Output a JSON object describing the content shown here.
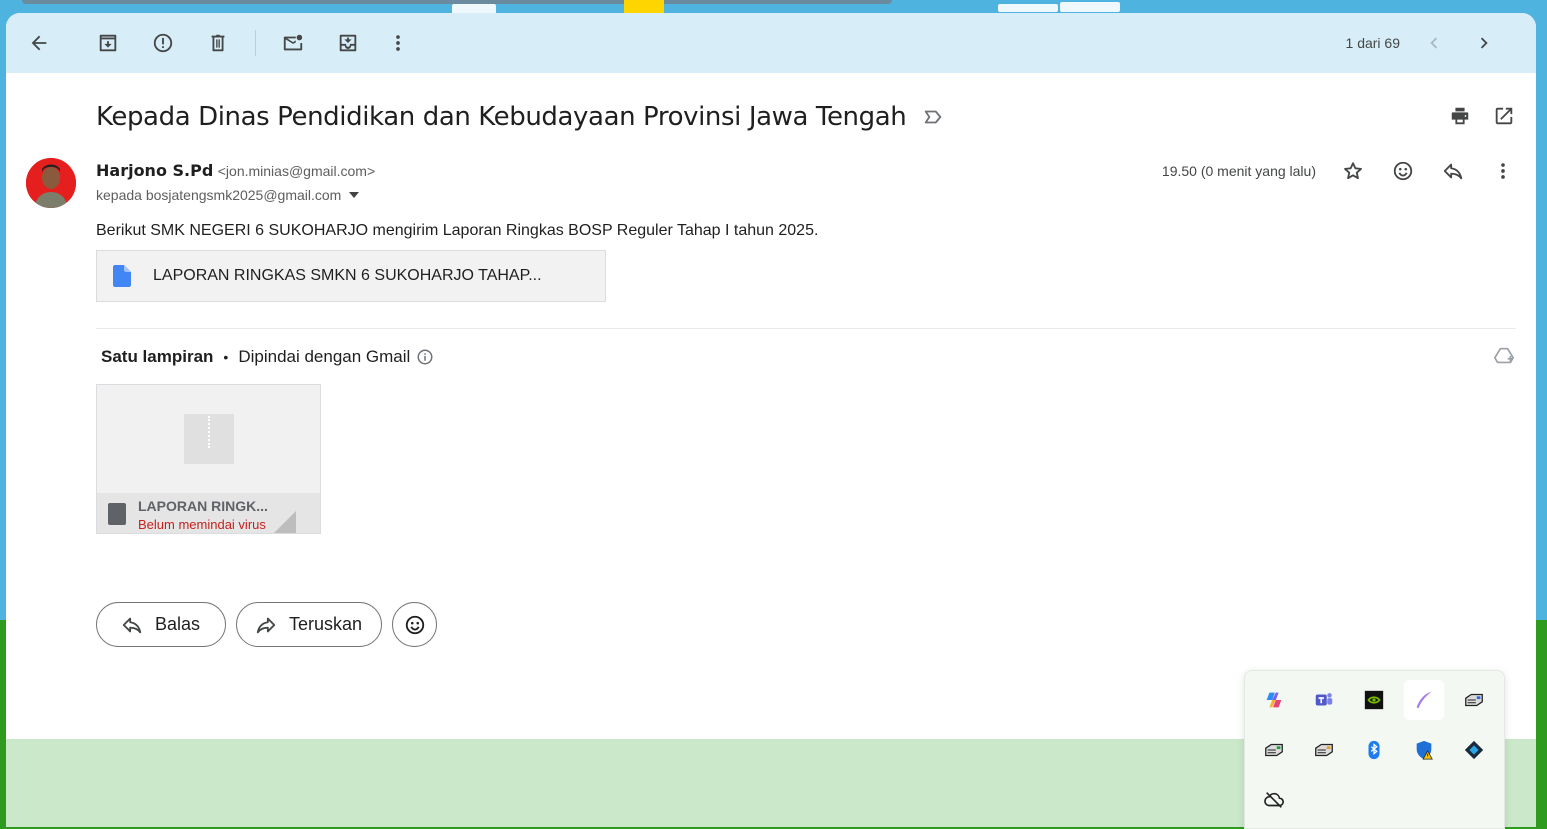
{
  "toolbar": {
    "buttons": [
      "back-icon",
      "archive-icon",
      "report-spam-icon",
      "delete-icon",
      "mark-unread-icon",
      "move-to-icon",
      "more-vert-icon"
    ],
    "pager_text": "1 dari 69"
  },
  "email": {
    "subject": "Kepada Dinas Pendidikan dan Kebudayaan Provinsi Jawa Tengah",
    "sender_name": "Harjono S.Pd",
    "sender_email": "<jon.minias@gmail.com>",
    "recipient_line": "kepada bosjatengsmk2025@gmail.com",
    "time": "19.50 (0 menit yang lalu)",
    "body": "Berikut SMK NEGERI 6 SUKOHARJO mengirim Laporan Ringkas BOSP Reguler Tahap I tahun 2025.",
    "doc_link": "LAPORAN RINGKAS SMKN 6 SUKOHARJO TAHAP..."
  },
  "attachments": {
    "count_label": "Satu lampiran",
    "separator": "•",
    "scan_label": "Dipindai dengan Gmail",
    "items": [
      {
        "name": "LAPORAN RINGK...",
        "status": "Belum memindai virus"
      }
    ]
  },
  "actions": {
    "reply_label": "Balas",
    "forward_label": "Teruskan"
  },
  "tray": {
    "icons": [
      "copilot-icon",
      "teams-icon",
      "nvidia-icon",
      "pen-icon",
      "app-icon",
      "app-icon",
      "app-icon",
      "bluetooth-icon",
      "security-warning-icon",
      "app-icon",
      "onedrive-offline-icon"
    ]
  },
  "colors": {
    "toolbar_bg": "#d7edf8",
    "status_red": "#c5221f",
    "doc_blue": "#4285f4"
  }
}
